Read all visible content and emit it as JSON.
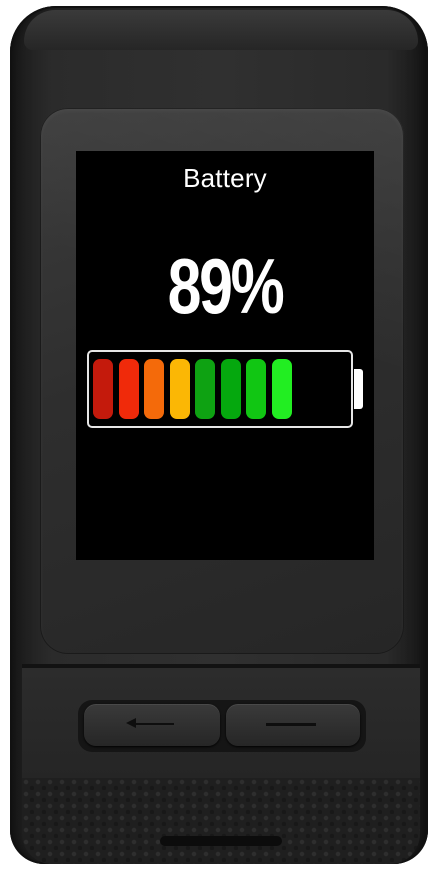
{
  "screen": {
    "title": "Battery",
    "percent_label": "89%"
  },
  "battery": {
    "level_percent": 89,
    "filled_segments": 8,
    "segment_colors": [
      "#c41a0c",
      "#f02a0a",
      "#f46a0a",
      "#fbb705",
      "#0ea212",
      "#05a80e",
      "#11c613",
      "#22ee22"
    ],
    "border_color": "#e6e6e6"
  },
  "hardware": {
    "back_button_icon": "back-arrow-icon",
    "lap_button_icon": "dash-icon"
  }
}
